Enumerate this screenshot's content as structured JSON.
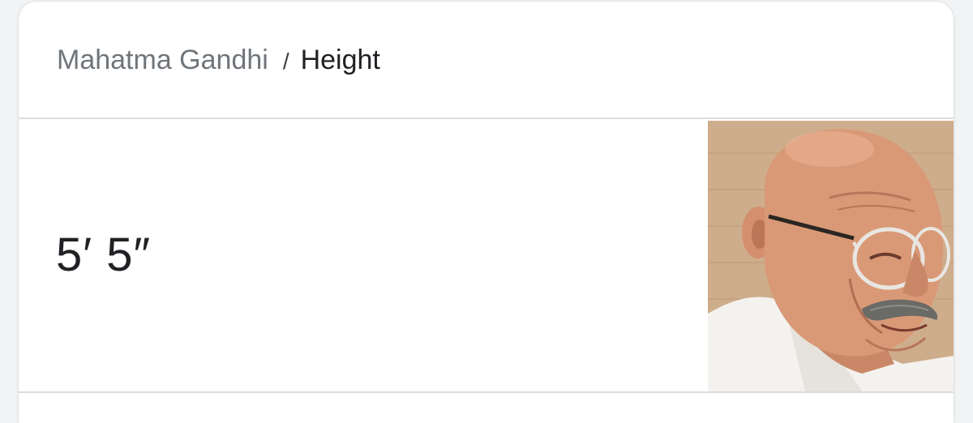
{
  "breadcrumb": {
    "parent": "Mahatma Gandhi",
    "separator": "/",
    "current": "Height"
  },
  "answer": {
    "value": "5′ 5″"
  },
  "image": {
    "subject": "portrait-photo",
    "colors": {
      "background": "#c9a684",
      "skin": "#d99977",
      "cloth": "#f4f2ef"
    }
  }
}
